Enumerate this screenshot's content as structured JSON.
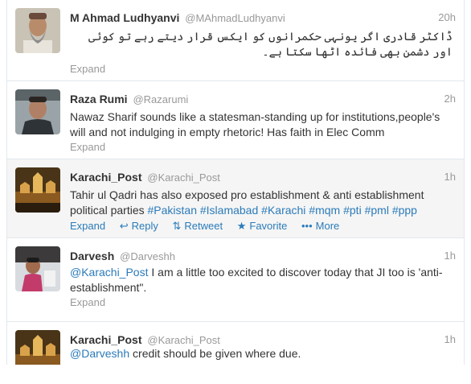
{
  "colors": {
    "link": "#2b7bb9",
    "muted": "#999999",
    "highlight_bg": "#f5f5f5"
  },
  "tweets": [
    {
      "name": "M Ahmad Ludhyanvi",
      "handle": "@MAhmadLudhyanvi",
      "time": "20h",
      "text": "ڈاکٹر قادری اگر یونہی حکمرانوں کو ایکس قرار دیتے رہے تو کوئی اور دشمن بھی فائدہ اٹھا سکتا ہے۔",
      "expand": "Expand"
    },
    {
      "name": "Raza Rumi",
      "handle": "@Razarumi",
      "time": "2h",
      "text": "Nawaz Sharif sounds like a statesman-standing up for institutions,people's will and not indulging in empty rhetoric! Has faith in Elec Comm",
      "expand": "Expand"
    },
    {
      "name": "Karachi_Post",
      "handle": "@Karachi_Post",
      "time": "1h",
      "text_line1": "Tahir ul Qadri has also exposed pro establishment & anti establishment",
      "text_line2_prefix": "political parties",
      "hashtags": [
        "#Pakistan",
        "#Islamabad",
        "#Karachi",
        "#mqm",
        "#pti",
        "#pml",
        "#ppp"
      ],
      "actions": {
        "expand": "Expand",
        "reply": "Reply",
        "retweet": "Retweet",
        "favorite": "Favorite",
        "more": "More"
      }
    },
    {
      "name": "Darvesh",
      "handle": "@Darveshh",
      "time": "1h",
      "mention": "@Karachi_Post",
      "text_rest": " I am a little too excited to discover today that JI too is 'anti-establishment\".",
      "expand": "Expand"
    },
    {
      "name": "Karachi_Post",
      "handle": "@Karachi_Post",
      "time": "1h",
      "mention": "@Darveshh",
      "text_rest": " credit should be given where due."
    }
  ]
}
